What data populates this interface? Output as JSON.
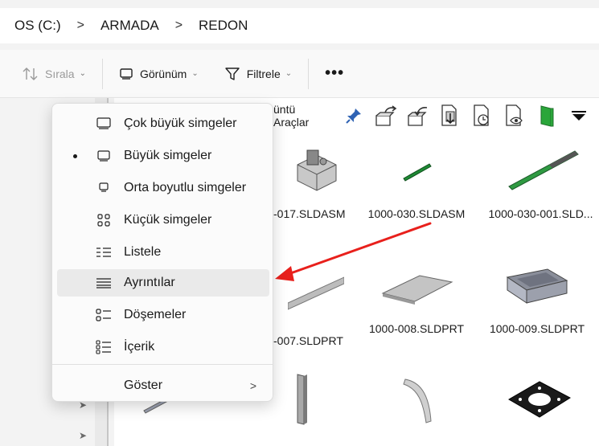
{
  "breadcrumb": {
    "items": [
      "OS (C:)",
      "ARMADA",
      "REDON"
    ],
    "separator": ">"
  },
  "toolbar": {
    "sort_label": "Sırala",
    "view_label": "Görünüm",
    "filter_label": "Filtrele",
    "more_label": "•••"
  },
  "sw_toolbar": {
    "menu_items": [
      "üntü",
      "Araçlar"
    ]
  },
  "files": [
    {
      "name": "-017.SLDASM"
    },
    {
      "name": "1000-030.SLDASM"
    },
    {
      "name": "1000-030-001.SLD..."
    },
    {
      "name": "-007.SLDPRT"
    },
    {
      "name": "1000-008.SLDPRT"
    },
    {
      "name": "1000-009.SLDPRT"
    }
  ],
  "view_menu": {
    "items": [
      {
        "label": "Çok büyük simgeler",
        "icon": "monitor-icon"
      },
      {
        "label": "Büyük simgeler",
        "icon": "monitor-icon",
        "checked": true
      },
      {
        "label": "Orta boyutlu simgeler",
        "icon": "monitor-small-icon"
      },
      {
        "label": "Küçük simgeler",
        "icon": "grid-icon"
      },
      {
        "label": "Listele",
        "icon": "list-icon"
      },
      {
        "label": "Ayrıntılar",
        "icon": "details-icon",
        "highlighted": true
      },
      {
        "label": "Döşemeler",
        "icon": "tiles-icon"
      },
      {
        "label": "İçerik",
        "icon": "content-icon"
      },
      {
        "label": "Göster",
        "icon": "",
        "submenu_glyph": ">"
      }
    ]
  },
  "colors": {
    "annotation_arrow": "#e8201c",
    "menu_highlight": "#eaeaea",
    "pin": "#2f63b4"
  }
}
